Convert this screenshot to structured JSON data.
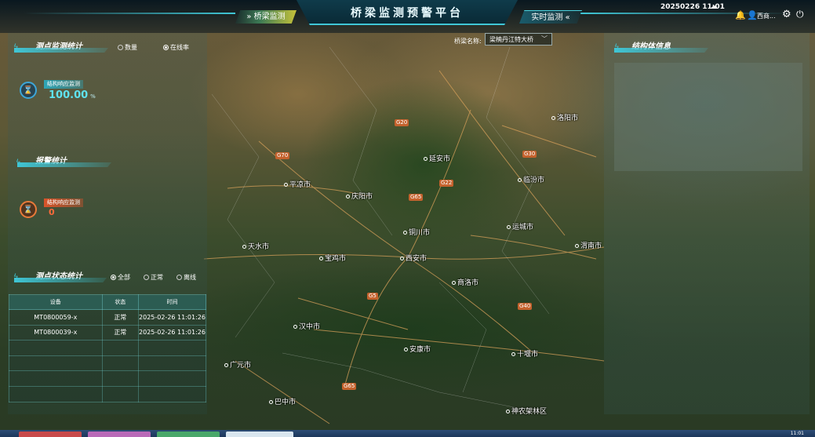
{
  "header": {
    "title": "桥梁监测预警平台",
    "nav_left": "桥梁监测",
    "nav_right": "实时监测",
    "date": "20250226 11:01",
    "username": "西商..."
  },
  "map": {
    "cities": [
      "宝鸡市",
      "西安市",
      "渭南市",
      "商洛市",
      "汉中市",
      "安康市",
      "十堰市",
      "巴中市",
      "广元市",
      "天水市",
      "铜川市",
      "运城市",
      "洛阳市",
      "平凉市",
      "庆阳市",
      "延安市",
      "临汾市",
      "神农架林区"
    ],
    "roads": [
      "G5",
      "G65",
      "G40",
      "G70",
      "G22",
      "G65",
      "G20",
      "G30"
    ]
  },
  "bridge_selector": {
    "label": "桥梁名称:",
    "value": "梁楠丹江特大桥"
  },
  "monitor_stats": {
    "title": "测点监测统计",
    "radio_count": "数量",
    "radio_online": "在线率",
    "selected": "在线率",
    "tag": "结构响应监测",
    "value": "100.00",
    "unit": "%"
  },
  "alarm_stats": {
    "title": "报警统计",
    "tag": "结构响应监测",
    "value": "0"
  },
  "status_stats": {
    "title": "测点状态统计",
    "radio_all": "全部",
    "radio_normal": "正常",
    "radio_offline": "离线",
    "selected": "全部",
    "columns": [
      "设备",
      "状态",
      "时间"
    ],
    "rows": [
      [
        "MT0800059-x",
        "正常",
        "2025-02-26 11:01:26"
      ],
      [
        "MT0800039-x",
        "正常",
        "2025-02-26 11:01:26"
      ],
      [
        "",
        "",
        ""
      ],
      [
        "",
        "",
        ""
      ],
      [
        "",
        "",
        ""
      ],
      [
        "",
        "",
        ""
      ]
    ]
  },
  "structure_info": {
    "title": "结构体信息"
  },
  "taskbar": {
    "clock": "11:01"
  }
}
